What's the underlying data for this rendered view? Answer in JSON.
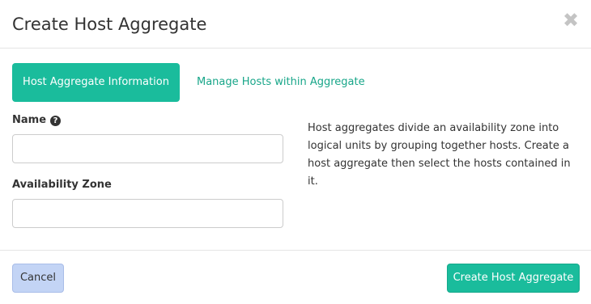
{
  "modal": {
    "title": "Create Host Aggregate",
    "close_symbol": "✖"
  },
  "tabs": [
    {
      "label": "Host Aggregate Information",
      "active": true
    },
    {
      "label": "Manage Hosts within Aggregate",
      "active": false
    }
  ],
  "form": {
    "name_label": "Name",
    "name_help_icon": "question-circle-icon",
    "name_value": "",
    "availability_zone_label": "Availability Zone",
    "availability_zone_value": ""
  },
  "help_text": "Host aggregates divide an availability zone into logical units by grouping together hosts. Create a host aggregate then select the hosts contained in it.",
  "footer": {
    "cancel_label": "Cancel",
    "submit_label": "Create Host Aggregate"
  },
  "colors": {
    "accent": "#1abc9c",
    "cancel_bg": "#c3d4f5"
  }
}
